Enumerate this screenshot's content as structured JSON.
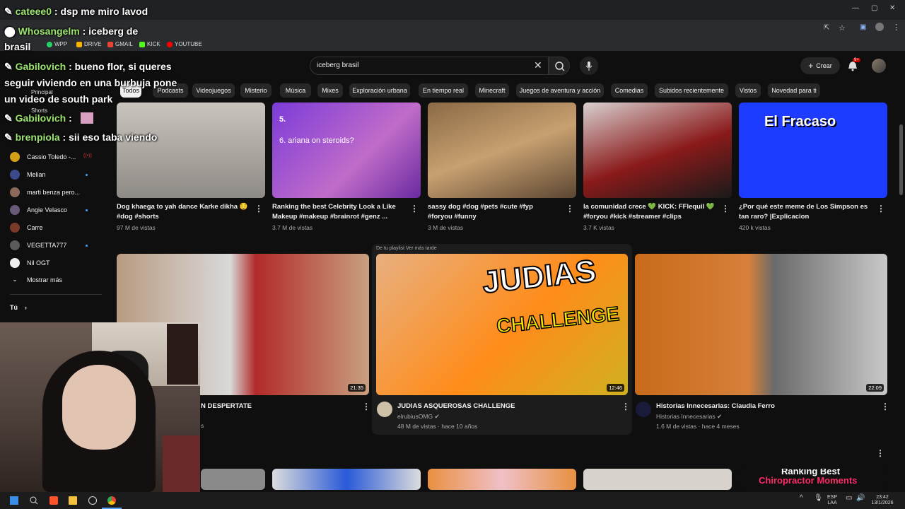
{
  "chat": [
    {
      "user": "cateee0",
      "message": ": dsp me miro lavod"
    },
    {
      "user": "Whosangelm",
      "message": ": iceberg de",
      "cont": "brasil"
    },
    {
      "user": "Gabilovich",
      "message": ": bueno flor, si queres",
      "cont": "seguir viviendo en una burbuja pone",
      "cont2": "un video de south park"
    },
    {
      "user": "Gabilovich",
      "message": ":"
    },
    {
      "user": "brenpiola",
      "message": ": sii eso taba viendo"
    }
  ],
  "bookmarks": [
    "WPP",
    "DRIVE",
    "GMAIL",
    "KICK",
    "YOUTUBE"
  ],
  "header": {
    "search_value": "iceberg brasil",
    "create_label": "Crear",
    "notif_badge": "9+"
  },
  "chips": [
    "Todos",
    "Podcasts",
    "Videojuegos",
    "Misterio",
    "Música",
    "Mixes",
    "Exploración urbana",
    "En tiempo real",
    "Minecraft",
    "Juegos de aventura y acción",
    "Comedias",
    "Subidos recientemente",
    "Vistos",
    "Novedad para ti"
  ],
  "sidebar": {
    "principal": "Principal",
    "shorts": "Shorts",
    "subs": [
      "Cassio Toledo -...",
      "Melian",
      "marti benza pero...",
      "Angie Velasco",
      "Carre",
      "VEGETTA777",
      "Nil OGT"
    ],
    "more": "Mostrar más",
    "you": "Tú"
  },
  "row1": [
    {
      "title1": "Dog khaega to yah dance Karke dikha 😌",
      "title2": "#dog #shorts",
      "meta": "97 M de vistas"
    },
    {
      "title1": "Ranking the best Celebrity Look a Like",
      "title2": "Makeup #makeup #brainrot #genz ...",
      "meta": "3.7 M de vistas",
      "overlay1": "5.",
      "overlay2": "6. ariana on steroids?"
    },
    {
      "title1": "sassy dog #dog #pets #cute #fyp",
      "title2": "#foryou #funny",
      "meta": "3 M de vistas"
    },
    {
      "title1": "la comunidad crece 💚 KICK: FFlequil 💚",
      "title2": "#foryou #kick #streamer #clips",
      "meta": "3.7 K vistas"
    },
    {
      "title1": "¿Por qué este meme de Los Simpson es",
      "title2": "tan raro? |Explicacion",
      "meta": "420 k vistas",
      "overlay1": "El Fracaso"
    }
  ],
  "row2": [
    {
      "title": "N DESPERTATE",
      "channel": "s",
      "duration": "21:35"
    },
    {
      "title": "JUDIAS ASQUEROSAS CHALLENGE",
      "channel": "elrubiusOMG",
      "meta": "48 M de vistas · hace 10 años",
      "duration": "12:46",
      "playlist": "De tu playlist Ver más tarde",
      "overlay1": "JUDIAS",
      "overlay2": "CHALLENGE"
    },
    {
      "title": "Historias Innecesarias: Claudia Ferro",
      "channel": "Historias Innecesarias",
      "meta": "1.6 M de vistas · hace 4 meses",
      "duration": "22:09"
    }
  ],
  "row3_overlay": {
    "line1": "Ranking Best",
    "line2": "Chiropractor Moments"
  },
  "tray": {
    "lang1": "ESP",
    "lang2": "LAA",
    "time": "23:42",
    "date": "13/1/2026"
  },
  "colors": {
    "bg": "#0f0f0f",
    "chip": "#272727",
    "accent_red": "#cc0000",
    "chat_user": "#9fe870"
  }
}
